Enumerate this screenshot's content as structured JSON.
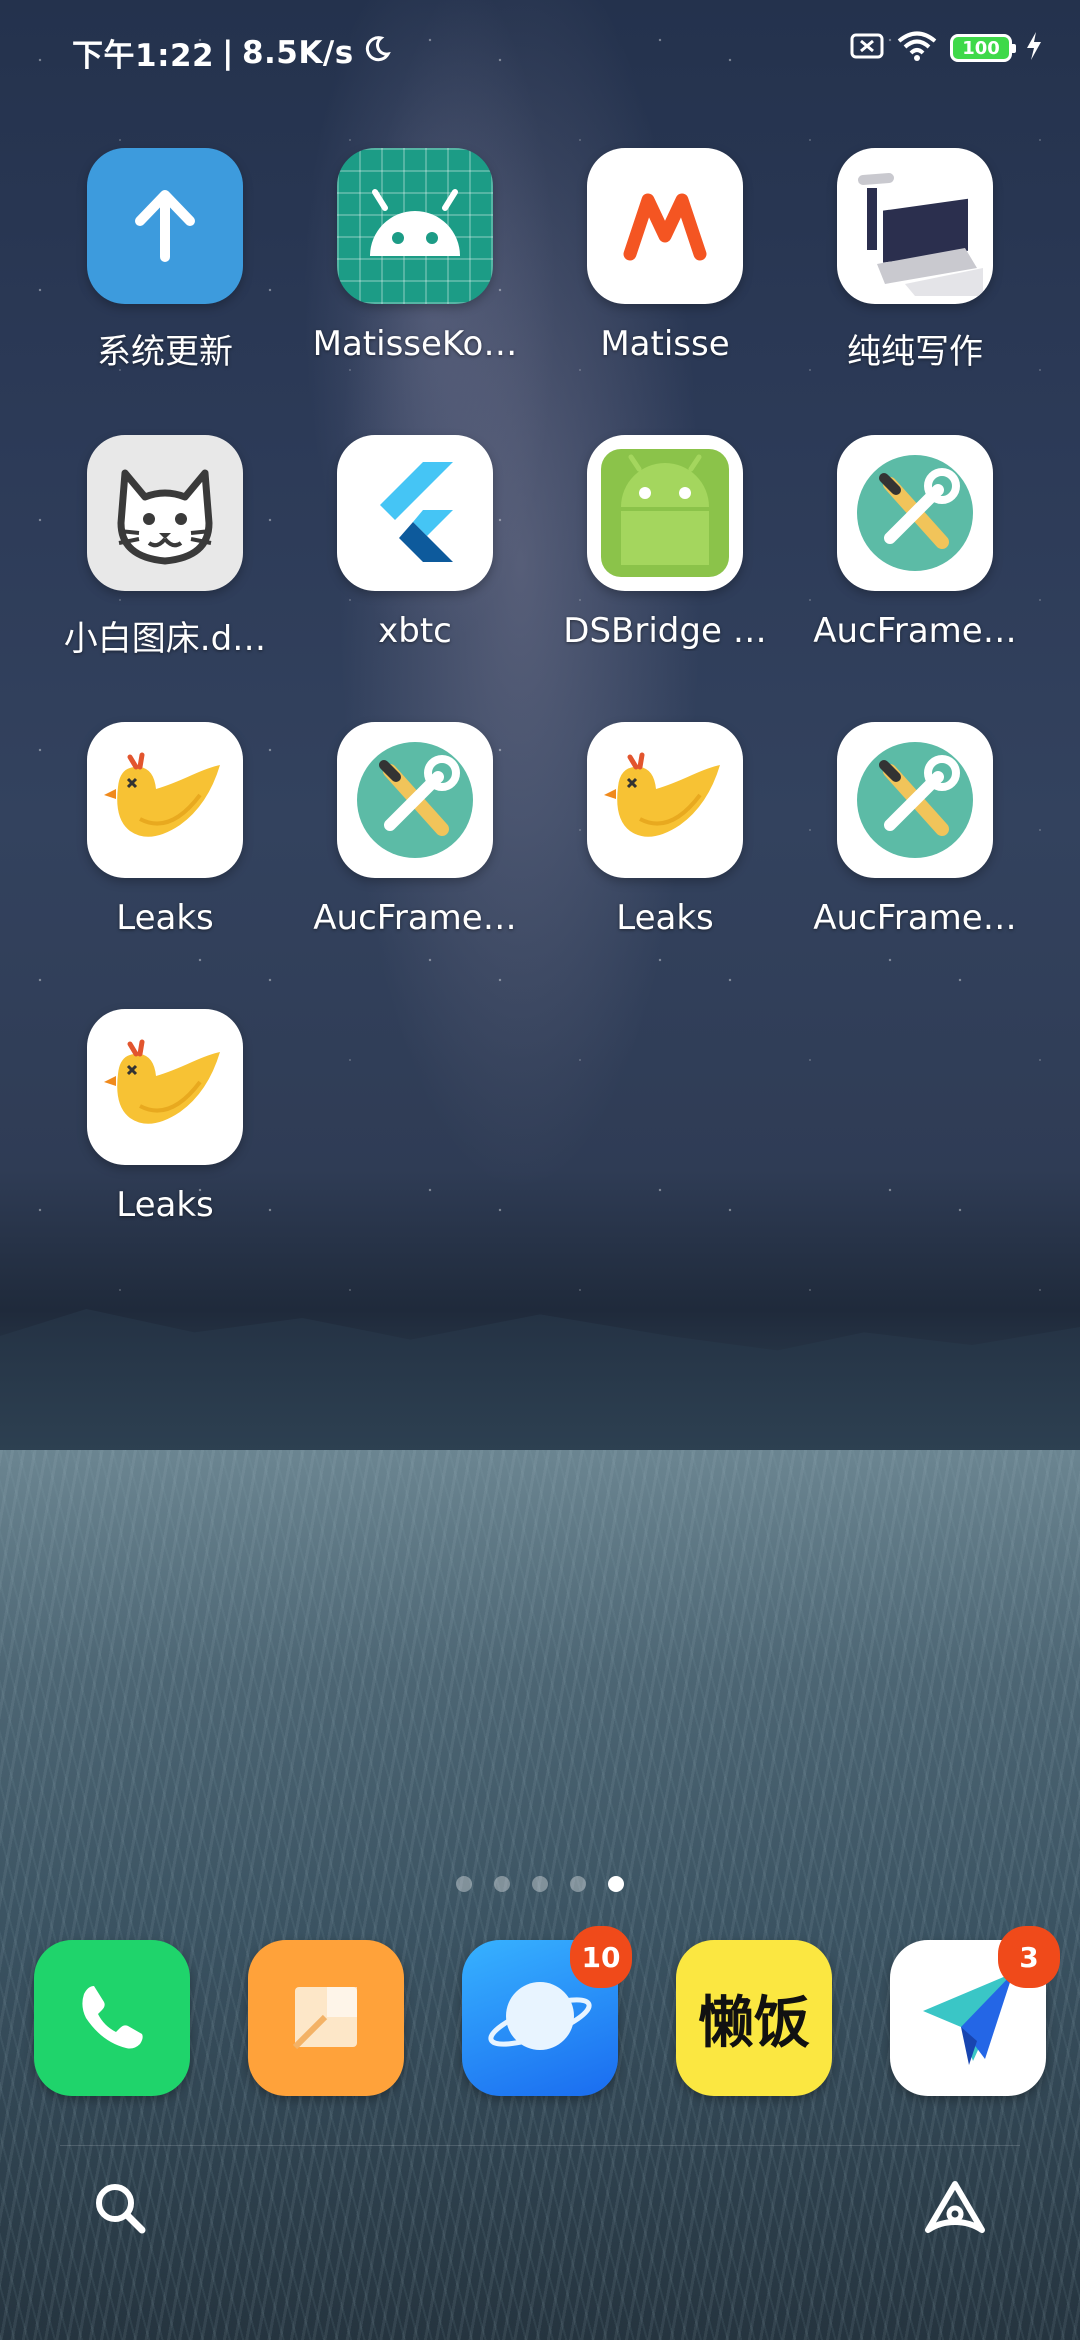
{
  "status_bar": {
    "time": "下午1:22",
    "separator": "|",
    "net_speed": "8.5K/s",
    "battery_level": "100",
    "icons": [
      "moon-icon",
      "sim-off-icon",
      "wifi-icon",
      "battery-icon",
      "charging-icon"
    ]
  },
  "apps": [
    {
      "label": "系统更新",
      "icon": "system-update-icon"
    },
    {
      "label": "MatisseKo…",
      "icon": "android-grid-icon"
    },
    {
      "label": "Matisse",
      "icon": "matisse-m-icon"
    },
    {
      "label": "纯纯写作",
      "icon": "typewriter-icon"
    },
    {
      "label": "小白图床.d…",
      "icon": "cat-icon"
    },
    {
      "label": "xbtc",
      "icon": "flutter-icon"
    },
    {
      "label": "DSBridge …",
      "icon": "android-robot-icon"
    },
    {
      "label": "AucFrame…",
      "icon": "tools-icon"
    },
    {
      "label": "Leaks",
      "icon": "leaks-bird-icon"
    },
    {
      "label": "AucFrame…",
      "icon": "tools-icon"
    },
    {
      "label": "Leaks",
      "icon": "leaks-bird-icon"
    },
    {
      "label": "AucFrame…",
      "icon": "tools-icon"
    },
    {
      "label": "Leaks",
      "icon": "leaks-bird-icon"
    }
  ],
  "page_indicator": {
    "count": 5,
    "active_index": 4
  },
  "dock": [
    {
      "name": "phone",
      "icon": "phone-icon",
      "badge": ""
    },
    {
      "name": "notes",
      "icon": "notes-icon",
      "badge": ""
    },
    {
      "name": "browser",
      "icon": "browser-planet-icon",
      "badge": "10"
    },
    {
      "name": "lanfan",
      "icon": "lanfan-icon",
      "text": "懒饭",
      "badge": ""
    },
    {
      "name": "paper-plane",
      "icon": "paper-plane-icon",
      "badge": "3"
    }
  ],
  "bottom_bar": {
    "left_icon": "search-icon",
    "right_icon": "assistant-icon"
  },
  "colors": {
    "badge": "#f04a1a",
    "battery_fill": "#3fd94a",
    "phone_green": "#1fd46b",
    "notes_orange": "#ffa23a",
    "browser_blue": "#1e8cf5",
    "lanfan_yellow": "#fbe741"
  }
}
